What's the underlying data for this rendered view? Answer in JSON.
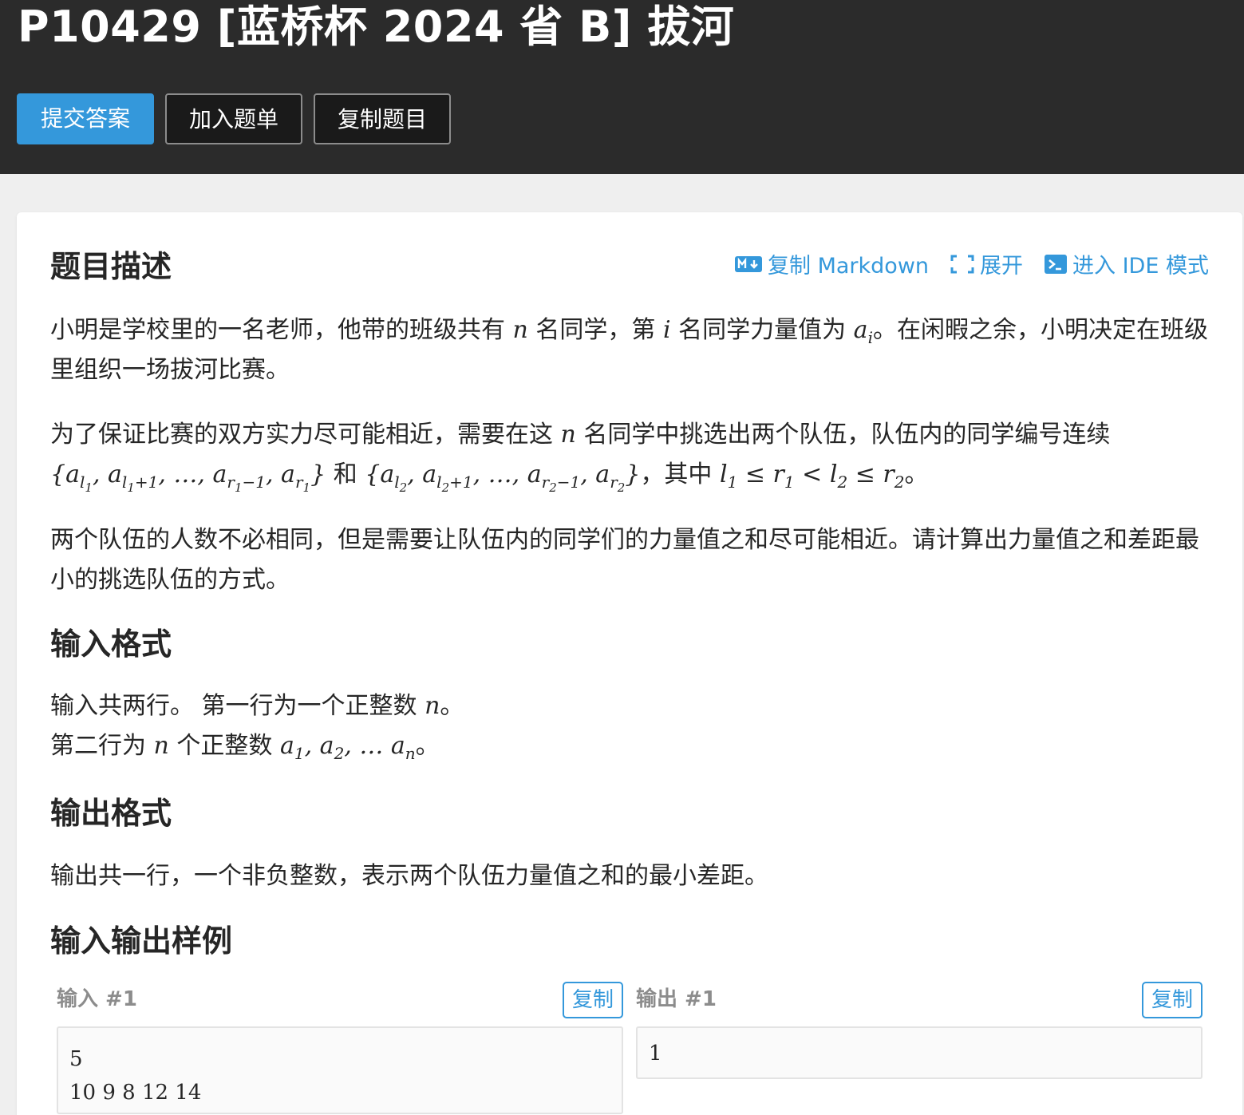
{
  "header": {
    "title": "P10429 [蓝桥杯 2024 省 B] 拔河",
    "buttons": {
      "submit": "提交答案",
      "add_list": "加入题单",
      "copy_problem": "复制题目"
    }
  },
  "tools": {
    "copy_markdown": "复制 Markdown",
    "expand": "展开",
    "ide": "进入 IDE 模式"
  },
  "sections": {
    "description": {
      "heading": "题目描述",
      "p1a": "小明是学校里的一名老师，他带的班级共有",
      "p1b": "名同学，第",
      "p1c": "名同学力量值为",
      "p1d": "。在闲暇之余，小明决定在班级里组织一场拔河比赛。",
      "p2a": "为了保证比赛的双方实力尽可能相近，需要在这",
      "p2b": "名同学中挑选出两个队伍，队伍内的同学编号连续",
      "p2c": "和",
      "p2d": "，其中",
      "p3": "两个队伍的人数不必相同，但是需要让队伍内的同学们的力量值之和尽可能相近。请计算出力量值之和差距最小的挑选队伍的方式。"
    },
    "input_format": {
      "heading": "输入格式",
      "l1a": "输入共两行。 第一行为一个正整数",
      "l2a": "第二行为",
      "l2b": "个正整数"
    },
    "output_format": {
      "heading": "输出格式",
      "text": "输出共一行，一个非负整数，表示两个队伍力量值之和的最小差距。"
    },
    "samples": {
      "heading": "输入输出样例",
      "input_label": "输入 #1",
      "output_label": "输出 #1",
      "copy_label": "复制",
      "input_value": "5\n10 9 8 12 14",
      "output_value": "1"
    }
  },
  "colors": {
    "header_bg": "#2b2b2b",
    "accent": "#3498db",
    "page_bg": "#efefef"
  }
}
